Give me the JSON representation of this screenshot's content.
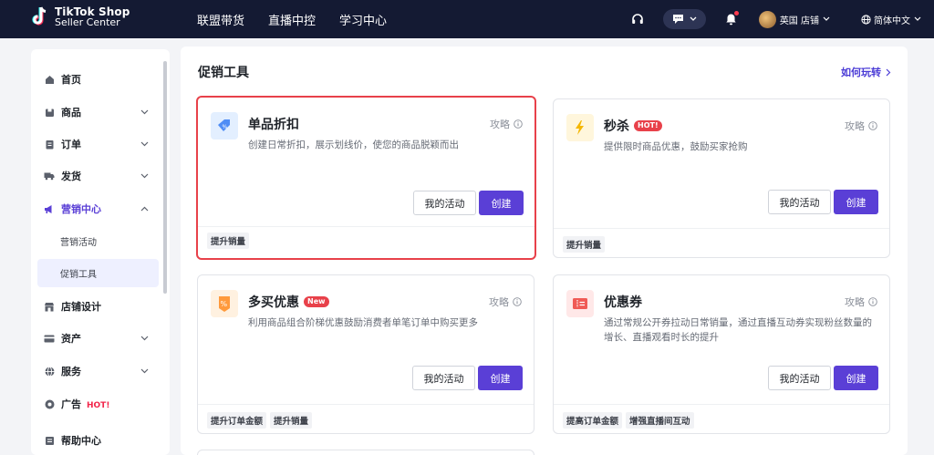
{
  "brand": {
    "line1": "TikTok Shop",
    "line2": "Seller Center"
  },
  "topnav": [
    "联盟带货",
    "直播中控",
    "学习中心"
  ],
  "header": {
    "store_name": "英国 店铺",
    "language": "简体中文"
  },
  "sidebar": {
    "items": [
      {
        "label": "首页",
        "icon": "home-icon"
      },
      {
        "label": "商品",
        "icon": "product-icon"
      },
      {
        "label": "订单",
        "icon": "order-icon"
      },
      {
        "label": "发货",
        "icon": "truck-icon"
      },
      {
        "label": "营销中心",
        "icon": "megaphone-icon"
      },
      {
        "label": "店铺设计",
        "icon": "store-icon"
      },
      {
        "label": "资产",
        "icon": "card-icon"
      },
      {
        "label": "服务",
        "icon": "globe-icon"
      },
      {
        "label": "广告",
        "icon": "ad-icon",
        "badge": "HOT!"
      },
      {
        "label": "帮助中心",
        "icon": "help-icon"
      }
    ],
    "sub_items": [
      "营销活动",
      "促销工具"
    ]
  },
  "main": {
    "title": "促销工具",
    "how_link": "如何玩转",
    "cards": [
      {
        "title": "单品折扣",
        "badge": "",
        "desc": "创建日常折扣，展示划线价，使您的商品脱颖而出",
        "guide": "攻略",
        "btn_activity": "我的活动",
        "btn_create": "创建",
        "tags": [
          "提升销量"
        ],
        "icon": "discount-tag-icon",
        "icon_bg": "#e3efff",
        "highlight": true
      },
      {
        "title": "秒杀",
        "badge": "HOT!",
        "desc": "提供限时商品优惠，鼓励买家抢购",
        "guide": "攻略",
        "btn_activity": "我的活动",
        "btn_create": "创建",
        "tags": [
          "提升销量"
        ],
        "icon": "lightning-icon",
        "icon_bg": "#fff6dc",
        "highlight": false
      },
      {
        "title": "多买优惠",
        "badge": "New",
        "desc": "利用商品组合阶梯优惠鼓励消费者单笔订单中购买更多",
        "guide": "攻略",
        "btn_activity": "我的活动",
        "btn_create": "创建",
        "tags": [
          "提升订单金额",
          "提升销量"
        ],
        "icon": "percent-badge-icon",
        "icon_bg": "#fff1e0",
        "highlight": false
      },
      {
        "title": "优惠券",
        "badge": "",
        "desc": "通过常规公开券拉动日常销量，通过直播互动券实现粉丝数量的增长、直播观看时长的提升",
        "guide": "攻略",
        "btn_activity": "我的活动",
        "btn_create": "创建",
        "tags": [
          "提高订单金额",
          "增强直播间互动"
        ],
        "icon": "coupon-icon",
        "icon_bg": "#ffe8e8",
        "highlight": false
      }
    ]
  },
  "colors": {
    "topbar": "#141a33",
    "primary": "#5a3fd6",
    "highlight": "#e8414a",
    "hot": "#f2264b"
  }
}
